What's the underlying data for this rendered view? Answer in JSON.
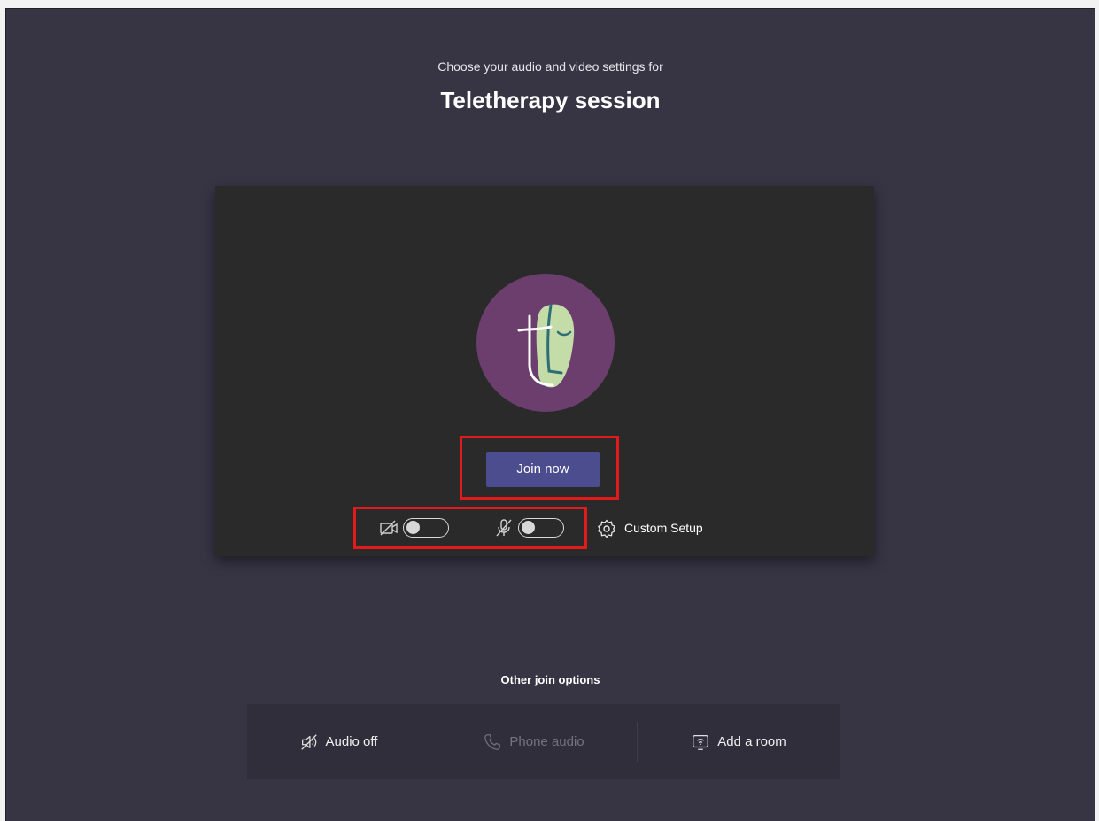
{
  "header": {
    "subtitle": "Choose your audio and video settings for",
    "title": "Teletherapy session"
  },
  "preview": {
    "join_button_label": "Join now",
    "video_toggle_on": false,
    "audio_toggle_on": false,
    "custom_setup_label": "Custom Setup"
  },
  "other_options": {
    "heading": "Other join options",
    "items": [
      {
        "label": "Audio off",
        "icon": "speaker-off-icon",
        "enabled": true
      },
      {
        "label": "Phone audio",
        "icon": "phone-icon",
        "enabled": false
      },
      {
        "label": "Add a room",
        "icon": "cast-room-icon",
        "enabled": true
      }
    ]
  },
  "colors": {
    "page_background": "#373444",
    "preview_background": "#2a2a2a",
    "join_button": "#4b4d8e",
    "avatar_background": "#6b3e6e",
    "highlight": "#e11b1b",
    "options_bar": "#302e3b"
  }
}
